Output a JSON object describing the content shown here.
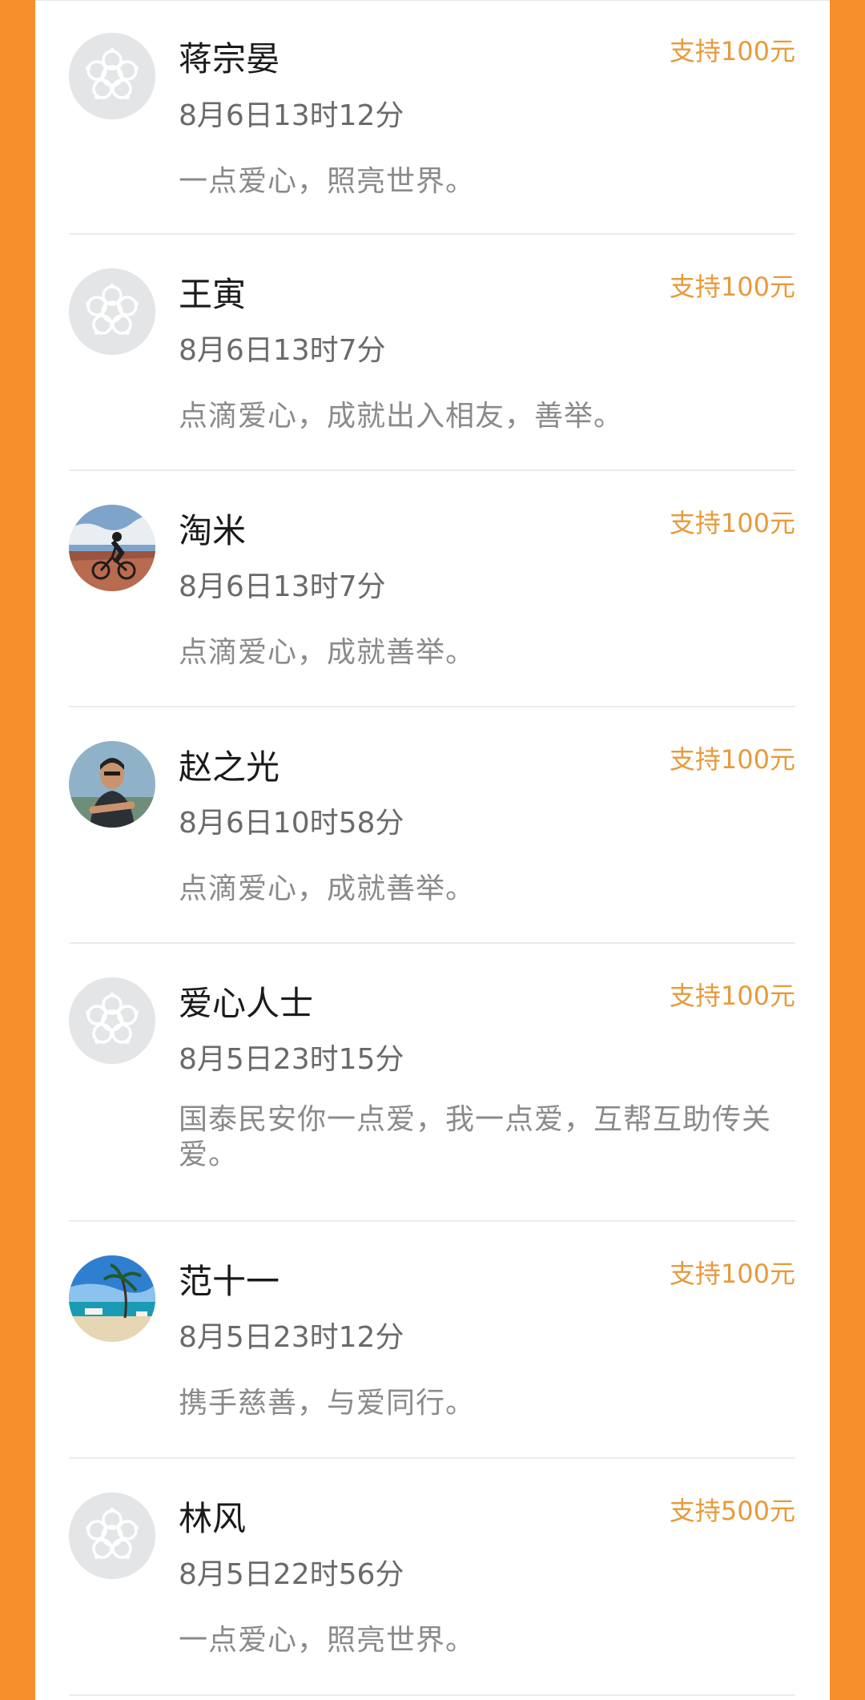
{
  "colors": {
    "page_background": "#f68f2c",
    "amount_text": "#e89a3a",
    "name_text": "#1a1a1a",
    "time_text": "#6a6a6a",
    "message_text": "#8a8a8a"
  },
  "supporters": [
    {
      "name": "蒋宗晏",
      "time": "8月6日13时12分",
      "message": "一点爱心，照亮世界。",
      "amount": "支持100元",
      "avatar": "default-flower-avatar"
    },
    {
      "name": "王寅",
      "time": "8月6日13时7分",
      "message": "点滴爱心，成就出入相友，善举。",
      "amount": "支持100元",
      "avatar": "default-flower-avatar"
    },
    {
      "name": "淘米",
      "time": "8月6日13时7分",
      "message": "点滴爱心，成就善举。",
      "amount": "支持100元",
      "avatar": "cyclist-photo-avatar"
    },
    {
      "name": "赵之光",
      "time": "8月6日10时58分",
      "message": "点滴爱心，成就善举。",
      "amount": "支持100元",
      "avatar": "man-photo-avatar"
    },
    {
      "name": "爱心人士",
      "time": "8月5日23时15分",
      "message": "国泰民安你一点爱，我一点爱，互帮互助传关爱。",
      "amount": "支持100元",
      "avatar": "default-flower-avatar"
    },
    {
      "name": "范十一",
      "time": "8月5日23时12分",
      "message": "携手慈善，与爱同行。",
      "amount": "支持100元",
      "avatar": "beach-photo-avatar"
    },
    {
      "name": "林风",
      "time": "8月5日22时56分",
      "message": "一点爱心，照亮世界。",
      "amount": "支持500元",
      "avatar": "default-flower-avatar"
    }
  ]
}
